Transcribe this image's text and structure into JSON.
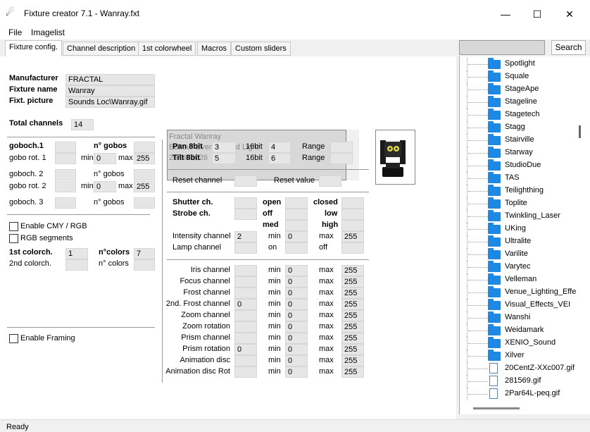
{
  "window": {
    "title": "Fixture creator 7.1 - Wanray.fxt",
    "minimize": "—",
    "maximize": "☐",
    "close": "✕"
  },
  "menu": {
    "file": "File",
    "imagelist": "Imagelist"
  },
  "tabs": [
    "Fixture config.",
    "Channel description",
    "1st colorwheel",
    "Macros",
    "Custom sliders"
  ],
  "search": {
    "button": "Search",
    "value": ""
  },
  "fixture": {
    "manufacturer_label": "Manufacturer",
    "manufacturer": "FRACTAL",
    "name_label": "Fixture name",
    "name": "Wanray",
    "picture_label": "Fixt. picture",
    "picture": "Sounds Loc\\Wanray.gif",
    "description": [
      "Fractal Wanray",
      "Editeur Event Sound Light",
      "26/08/2026"
    ],
    "total_channels_label": "Total channels",
    "total_channels": "14"
  },
  "gobo": {
    "goboch1": "goboch.1",
    "ngobos": "n° gobos",
    "gobo_rot1": "gobo rot. 1",
    "goboch2": "goboch. 2",
    "ngobos2": "n° gobos",
    "gobo_rot2": "gobo rot. 2",
    "goboch3": "goboch. 3",
    "ngobos3": "n° gobos",
    "min": "min",
    "max": "max",
    "rot1_min": "0",
    "rot1_max": "255",
    "rot2_min": "0",
    "rot2_max": "255"
  },
  "options": {
    "cmy": "Enable CMY / RGB",
    "rgb_seg": "RGB segments",
    "framing": "Enable Framing"
  },
  "color": {
    "first_label": "1st colorch.",
    "first": "1",
    "ncolors_label": "n°colors",
    "ncolors": "7",
    "second_label": "2nd colorch.",
    "ncolors2_label": "n° colors"
  },
  "pantilt": {
    "pan_label": "Pan 8bit",
    "pan": "3",
    "tilt_label": "Tilt 8bit",
    "tilt": "5",
    "bit16": "16bit",
    "pan16": "4",
    "tilt16": "6",
    "range": "Range"
  },
  "reset": {
    "channel": "Reset channel",
    "value": "Reset value"
  },
  "shutter": {
    "shutter": "Shutter ch.",
    "strobe": "Strobe ch.",
    "open": "open",
    "closed": "closed",
    "off": "off",
    "low": "low",
    "med": "med",
    "high": "high",
    "intensity": "Intensity channel",
    "intensity_val": "2",
    "min": "min",
    "min_val": "0",
    "max": "max",
    "max_val": "255",
    "lamp": "Lamp channel",
    "on": "on",
    "off2": "off"
  },
  "channels": [
    {
      "label": "Iris channel",
      "value": "",
      "min": "0",
      "max": "255"
    },
    {
      "label": "Focus channel",
      "value": "",
      "min": "0",
      "max": "255"
    },
    {
      "label": "Frost channel",
      "value": "",
      "min": "0",
      "max": "255"
    },
    {
      "label": "2nd. Frost channel",
      "value": "0",
      "min": "0",
      "max": "255"
    },
    {
      "label": "Zoom channel",
      "value": "",
      "min": "0",
      "max": "255"
    },
    {
      "label": "Zoom rotation",
      "value": "",
      "min": "0",
      "max": "255"
    },
    {
      "label": "Prism channel",
      "value": "",
      "min": "0",
      "max": "255"
    },
    {
      "label": "Prism rotation",
      "value": "0",
      "min": "0",
      "max": "255"
    },
    {
      "label": "Animation disc",
      "value": "",
      "min": "0",
      "max": "255"
    },
    {
      "label": "Animation disc Rot",
      "value": "",
      "min": "0",
      "max": "255"
    }
  ],
  "minmax": {
    "min": "min",
    "max": "max"
  },
  "tree": [
    {
      "type": "folder",
      "name": "Spotlight"
    },
    {
      "type": "folder",
      "name": "Squale"
    },
    {
      "type": "folder",
      "name": "StageApe"
    },
    {
      "type": "folder",
      "name": "Stageline"
    },
    {
      "type": "folder",
      "name": "Stagetech"
    },
    {
      "type": "folder",
      "name": "Stagg"
    },
    {
      "type": "folder",
      "name": "Stairville"
    },
    {
      "type": "folder",
      "name": "Starway"
    },
    {
      "type": "folder",
      "name": "StudioDue"
    },
    {
      "type": "folder",
      "name": "TAS"
    },
    {
      "type": "folder",
      "name": "Teilighthing"
    },
    {
      "type": "folder",
      "name": "Toplite"
    },
    {
      "type": "folder",
      "name": "Twinkling_Laser"
    },
    {
      "type": "folder",
      "name": "UKing"
    },
    {
      "type": "folder",
      "name": "Ultralite"
    },
    {
      "type": "folder",
      "name": "Varilite"
    },
    {
      "type": "folder",
      "name": "Varytec"
    },
    {
      "type": "folder",
      "name": "Velleman"
    },
    {
      "type": "folder",
      "name": "Venue_Lighting_Effe"
    },
    {
      "type": "folder",
      "name": "Visual_Effects_VEI"
    },
    {
      "type": "folder",
      "name": "Wanshi"
    },
    {
      "type": "folder",
      "name": "Weidamark"
    },
    {
      "type": "folder",
      "name": "XENIO_Sound"
    },
    {
      "type": "folder",
      "name": "Xilver"
    },
    {
      "type": "file",
      "name": "20CentZ-XXc007.gif"
    },
    {
      "type": "file",
      "name": "281569.gif"
    },
    {
      "type": "file",
      "name": "2Par64L-peq.gif"
    }
  ],
  "status": "Ready",
  "colors": {
    "folder": "#1e88e5",
    "field": "#e6e6e6"
  }
}
